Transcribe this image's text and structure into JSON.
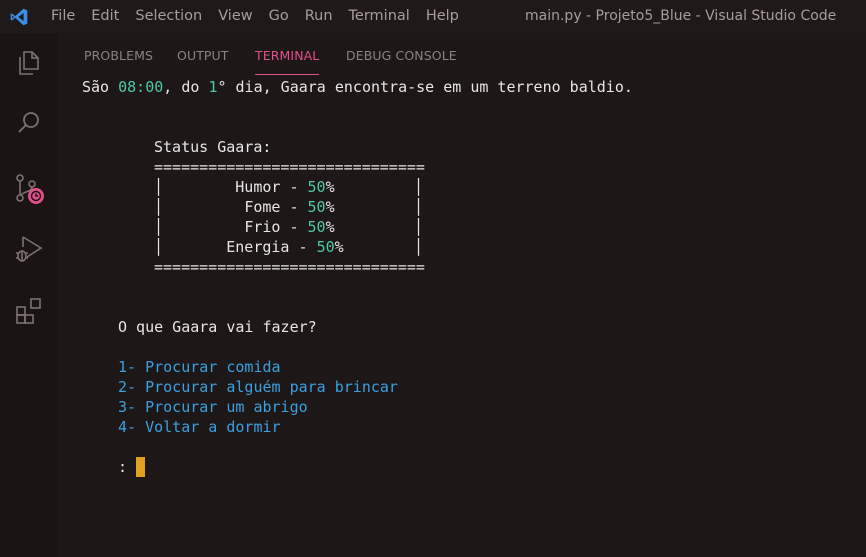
{
  "menu": [
    "File",
    "Edit",
    "Selection",
    "View",
    "Go",
    "Run",
    "Terminal",
    "Help"
  ],
  "window_title": "main.py - Projeto5_Blue - Visual Studio Code",
  "activity_icons": [
    "explorer-icon",
    "search-icon",
    "source-control-icon",
    "run-debug-icon",
    "extensions-icon"
  ],
  "tabs": [
    "PROBLEMS",
    "OUTPUT",
    "TERMINAL",
    "DEBUG CONSOLE"
  ],
  "active_tab": "TERMINAL",
  "terminal": {
    "intro": {
      "pre": "São ",
      "time": "08:00",
      "mid": ", do ",
      "day": "1",
      "post": "° dia, Gaara encontra-se em um terreno baldio."
    },
    "status_title": "Status Gaara:",
    "rule": "==============================",
    "status": [
      {
        "pad": "        ",
        "label": "Humor - ",
        "value": "50",
        "unit": "%"
      },
      {
        "pad": "         ",
        "label": "Fome - ",
        "value": "50",
        "unit": "%"
      },
      {
        "pad": "         ",
        "label": "Frio - ",
        "value": "50",
        "unit": "%"
      },
      {
        "pad": "       ",
        "label": "Energia - ",
        "value": "50",
        "unit": "%"
      }
    ],
    "question": "O que Gaara vai fazer?",
    "options": [
      "1- Procurar comida",
      "2- Procurar alguém para brincar",
      "3- Procurar um abrigo",
      "4- Voltar a dormir"
    ],
    "prompt": ": "
  },
  "colors": {
    "accent": "#e0508a",
    "number": "#4ec9a8",
    "option": "#3aa0e0",
    "cursor": "#e0a020"
  }
}
